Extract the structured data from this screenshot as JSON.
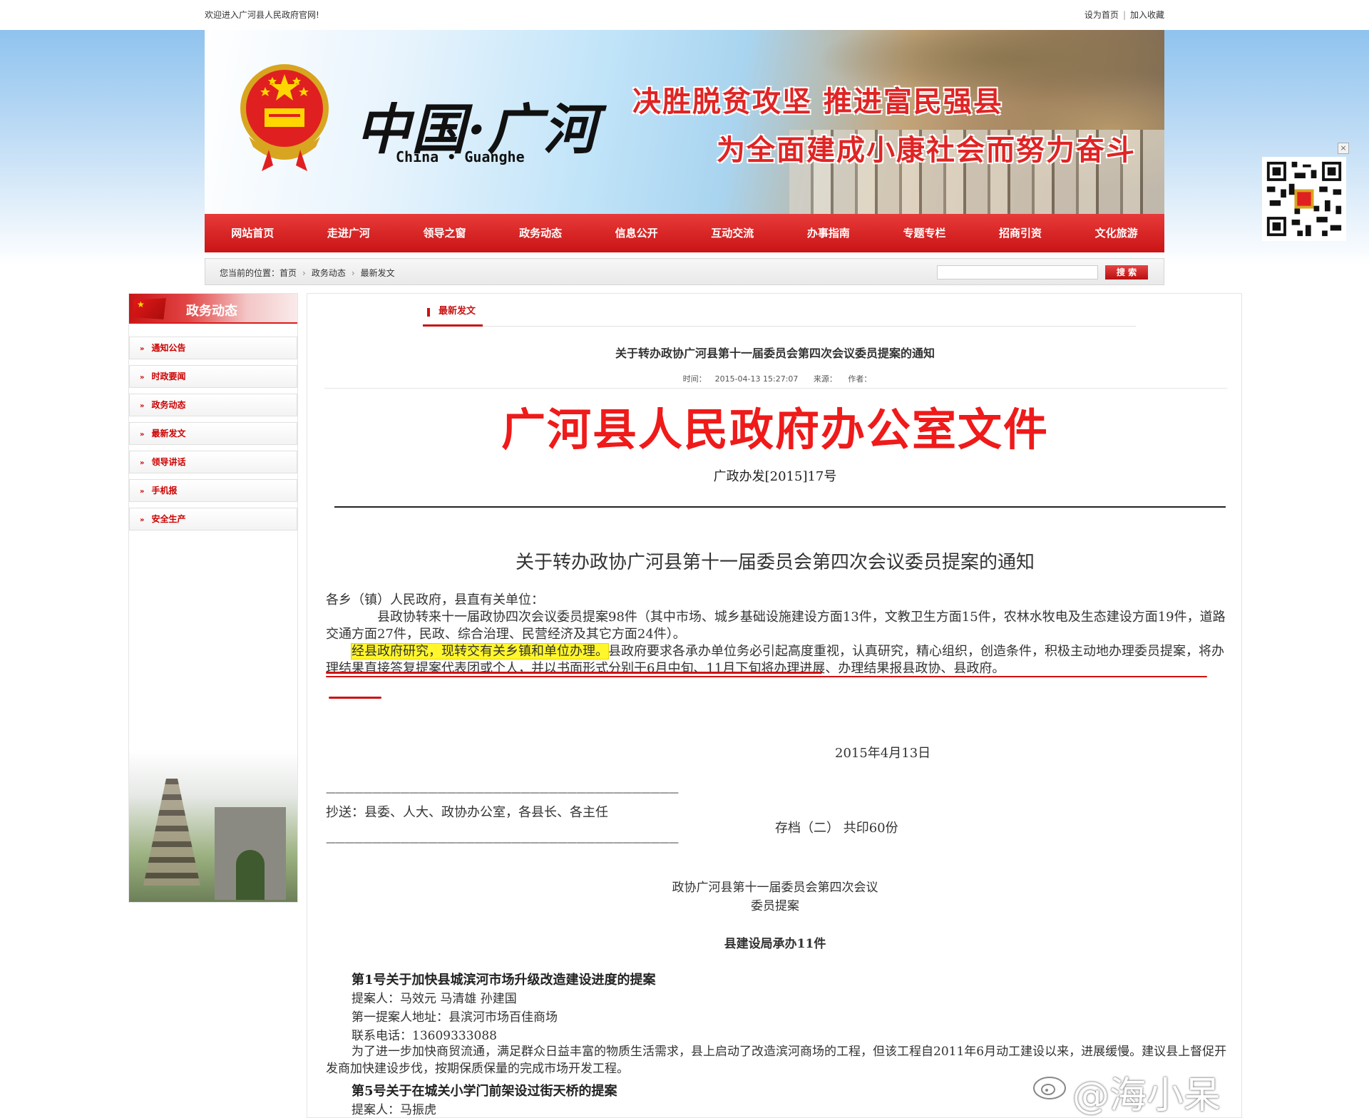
{
  "topbar": {
    "welcome": "欢迎进入广河县人民政府官网!",
    "set_home": "设为首页",
    "bookmark": "加入收藏"
  },
  "banner": {
    "logo_cn": "中国·广河",
    "logo_en": "China • Guanghe",
    "slogan1": "决胜脱贫攻坚  推进富民强县",
    "slogan2": "为全面建成小康社会而努力奋斗"
  },
  "nav": {
    "items": [
      "网站首页",
      "走进广河",
      "领导之窗",
      "政务动态",
      "信息公开",
      "互动交流",
      "办事指南",
      "专题专栏",
      "招商引资",
      "文化旅游"
    ]
  },
  "breadcrumb": {
    "label": "您当前的位置：",
    "items": [
      "首页",
      "政务动态",
      "最新发文"
    ],
    "search_button": "搜 索",
    "search_value": ""
  },
  "sidebar": {
    "title": "政务动态",
    "items": [
      "通知公告",
      "时政要闻",
      "政务动态",
      "最新发文",
      "领导讲话",
      "手机报",
      "安全生产"
    ]
  },
  "article": {
    "tab": "最新发文",
    "title": "关于转办政协广河县第十一届委员会第四次会议委员提案的通知",
    "time_label": "时间：",
    "time": "2015-04-13 15:27:07",
    "source_label": "来源：",
    "author_label": "作者："
  },
  "document": {
    "header": "广河县人民政府办公室文件",
    "number": "广政办发[2015]17号",
    "title": "关于转办政协广河县第十一届委员会第四次会议委员提案的通知",
    "salutation": "各乡（镇）人民政府，县直有关单位：",
    "body1": "县政协转来十一届政协四次会议委员提案98件（其中市场、城乡基础设施建设方面13件，文教卫生方面15件，农林水牧电及生态建设方面19件，道路交通方面27件，民政、综合治理、民营经济及其它方面24件）。",
    "body2_highlight": "经县政府研究，现转交有关乡镇和单位办理。",
    "body2_rest": "县政府要求各承办单位务必引起高度重视，认真研究，精心组织，创造条件，积极主动地办理委员提案，将办理结果直接答复提案代表团或个人，并以书面形式分别于6月中旬、11月下旬将办理进展、办理结果报县政协、县政府。",
    "date": "2015年4月13日",
    "dash_line": "——————————————————————————————————————",
    "cc": "抄送：县委、人大、政协办公室，各县长、各主任",
    "archive": "存档（二）  共印60份",
    "session_line1": "政协广河县第十一届委员会第四次会议",
    "session_line2": "委员提案",
    "dept": "县建设局承办11件",
    "proposal1_title": "第1号关于加快县城滨河市场升级改造建设进度的提案",
    "proposal1_proposer": "提案人：马效元  马清雄  孙建国",
    "proposal1_address": "第一提案人地址：县滨河市场百佳商场",
    "proposal1_phone": "联系电话：13609333088",
    "proposal1_desc": "为了进一步加快商贸流通，满足群众日益丰富的物质生活需求，县上启动了改造滨河商场的工程，但该工程自2011年6月动工建设以来，进展缓慢。建议县上督促开发商加快建设步伐，按期保质保量的完成市场开发工程。",
    "proposal5_title": "第5号关于在城关小学门前架设过街天桥的提案",
    "proposal5_proposer": "提案人：马振虎"
  },
  "watermark": "@海小呆",
  "colors": {
    "brand_red": "#c81414",
    "doc_red": "#ef1a1a",
    "highlight": "#fff62b"
  }
}
